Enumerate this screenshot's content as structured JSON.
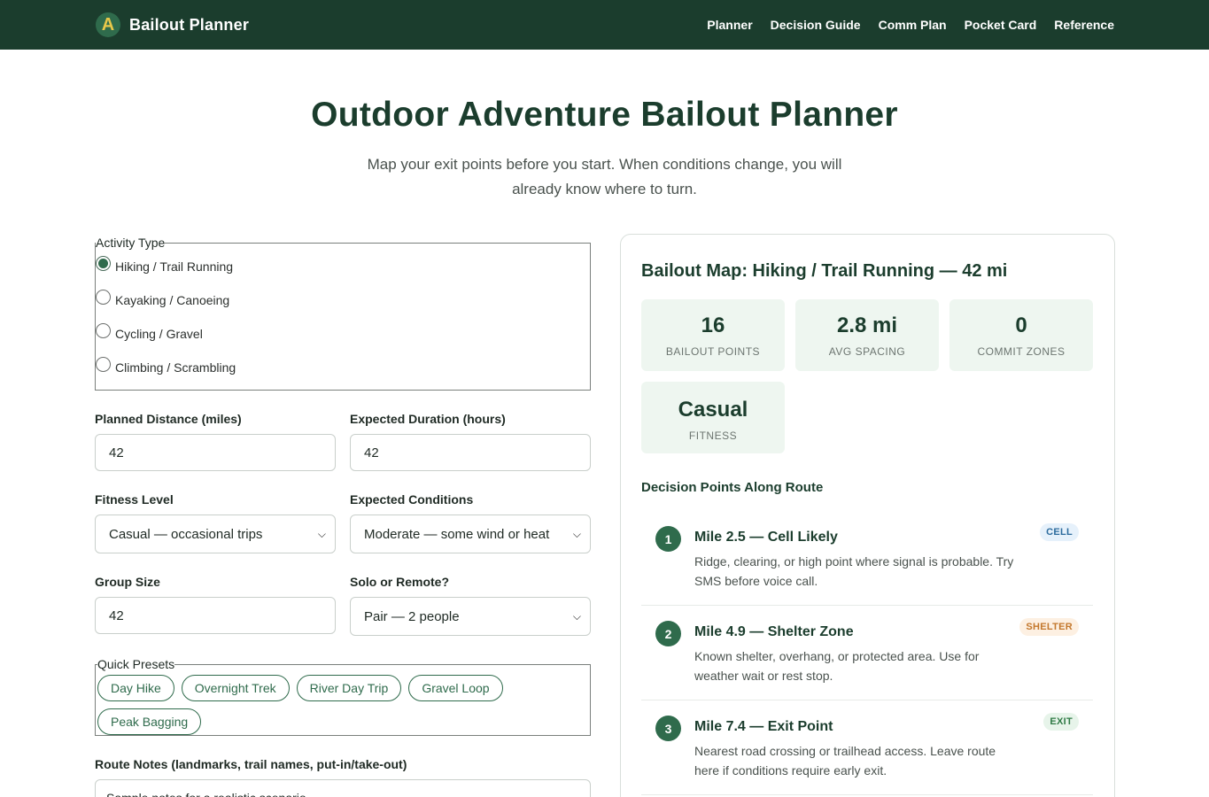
{
  "header": {
    "logo_letter": "A",
    "brand": "Bailout Planner",
    "nav": [
      "Planner",
      "Decision Guide",
      "Comm Plan",
      "Pocket Card",
      "Reference"
    ]
  },
  "hero": {
    "title": "Outdoor Adventure Bailout Planner",
    "subtitle": "Map your exit points before you start. When conditions change, you will already know where to turn."
  },
  "form": {
    "activity_legend": "Activity Type",
    "activities": [
      {
        "label": "Hiking / Trail Running",
        "checked": true
      },
      {
        "label": "Kayaking / Canoeing",
        "checked": false
      },
      {
        "label": "Cycling / Gravel",
        "checked": false
      },
      {
        "label": "Climbing / Scrambling",
        "checked": false
      }
    ],
    "distance_label": "Planned Distance (miles)",
    "distance_value": "42",
    "duration_label": "Expected Duration (hours)",
    "duration_value": "42",
    "fitness_label": "Fitness Level",
    "fitness_value": "Casual — occasional trips",
    "conditions_label": "Expected Conditions",
    "conditions_value": "Moderate — some wind or heat",
    "group_label": "Group Size",
    "group_value": "42",
    "solo_label": "Solo or Remote?",
    "solo_value": "Pair — 2 people",
    "presets_legend": "Quick Presets",
    "presets": [
      "Day Hike",
      "Overnight Trek",
      "River Day Trip",
      "Gravel Loop",
      "Peak Bagging"
    ],
    "notes_label": "Route Notes (landmarks, trail names, put-in/take-out)",
    "notes_value": "Sample notes for a realistic scenario"
  },
  "map": {
    "title": "Bailout Map: Hiking / Trail Running — 42 mi",
    "stats": [
      {
        "value": "16",
        "label": "BAILOUT POINTS"
      },
      {
        "value": "2.8 mi",
        "label": "AVG SPACING"
      },
      {
        "value": "0",
        "label": "COMMIT ZONES"
      },
      {
        "value": "Casual",
        "label": "FITNESS"
      }
    ],
    "decision_title": "Decision Points Along Route",
    "points": [
      {
        "num": "1",
        "name": "Mile 2.5 — Cell Likely",
        "desc": "Ridge, clearing, or high point where signal is probable. Try SMS before voice call.",
        "tag": "CELL"
      },
      {
        "num": "2",
        "name": "Mile 4.9 — Shelter Zone",
        "desc": "Known shelter, overhang, or protected area. Use for weather wait or rest stop.",
        "tag": "SHELTER"
      },
      {
        "num": "3",
        "name": "Mile 7.4 — Exit Point",
        "desc": "Nearest road crossing or trailhead access. Leave route here if conditions require early exit.",
        "tag": "EXIT"
      }
    ]
  }
}
